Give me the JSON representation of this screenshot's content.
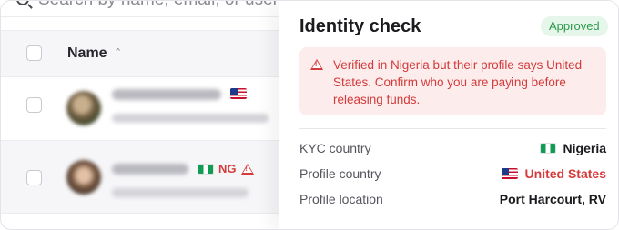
{
  "search": {
    "placeholder": "Search by name, email, or username"
  },
  "table": {
    "header_name": "Name",
    "rows": [
      {
        "flag": "us-flag-icon"
      },
      {
        "flag": "ng-flag-icon",
        "country_code": "NG",
        "warning": true
      }
    ]
  },
  "panel": {
    "title": "Identity check",
    "badge": "Approved",
    "alert": "Verified in Nigeria but their profile says United States. Confirm who you are paying before releasing funds.",
    "details": [
      {
        "label": "KYC country",
        "value": "Nigeria",
        "flag": "ng-flag-icon"
      },
      {
        "label": "Profile country",
        "value": "United States",
        "flag": "us-flag-icon",
        "mismatch": true
      },
      {
        "label": "Profile location",
        "value": "Port Harcourt, RV"
      }
    ]
  },
  "colors": {
    "danger": "#d63b3b",
    "alert_bg": "#fdecec",
    "success_text": "#2c9a4a",
    "success_bg": "#e6f6ea"
  }
}
